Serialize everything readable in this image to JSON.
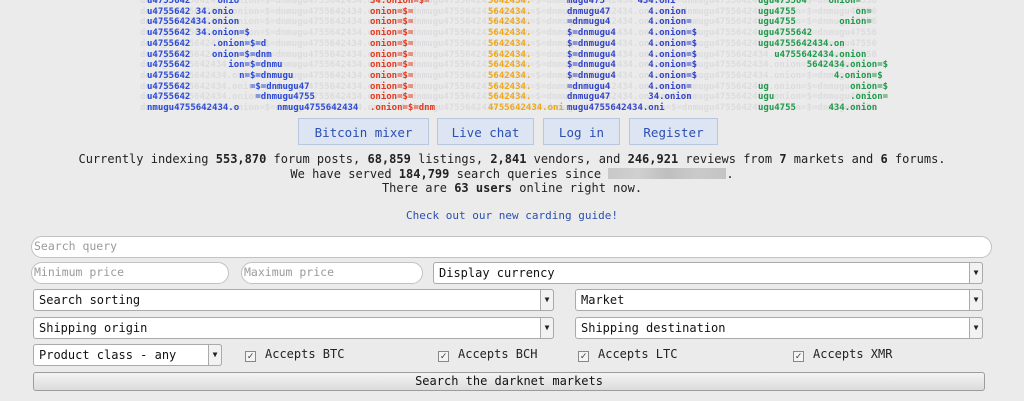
{
  "nav": {
    "items": [
      {
        "label": "Bitcoin mixer"
      },
      {
        "label": "Live chat"
      },
      {
        "label": "Log in"
      },
      {
        "label": "Register"
      }
    ]
  },
  "stats": {
    "line1_prefix": "Currently indexing ",
    "forum_posts": "553,870",
    "line1_a": " forum posts, ",
    "listings": "68,859",
    "line1_b": " listings, ",
    "vendors": "2,841",
    "line1_c": " vendors, and ",
    "reviews": "246,921",
    "line1_d": " reviews from ",
    "markets": "7",
    "line1_e": " markets and ",
    "forums": "6",
    "line1_f": " forums.",
    "line2_prefix": "We have served ",
    "queries": "184,799",
    "line2_suffix": " search queries since ",
    "line2_end": ".",
    "line3_prefix": "There are ",
    "users": "63 users",
    "line3_suffix": " online right now."
  },
  "guide_link": "Check out our new carding guide!",
  "form": {
    "search_placeholder": "Search query",
    "min_price_placeholder": "Minimum price",
    "max_price_placeholder": "Maximum price",
    "currency": "Display currency",
    "sorting": "Search sorting",
    "market": "Market",
    "shipping_origin": "Shipping origin",
    "shipping_destination": "Shipping destination",
    "product_class": "Product class - any",
    "checkboxes": [
      {
        "label": "Accepts BTC",
        "checked": true
      },
      {
        "label": "Accepts BCH",
        "checked": true
      },
      {
        "label": "Accepts LTC",
        "checked": true
      },
      {
        "label": "Accepts XMR",
        "checked": true
      }
    ],
    "submit": "Search the darknet markets"
  },
  "banner": {
    "col_blue": "u4755642     onio\nu4755642 34.onio\nu4755642434.onion\nu4755642 34.onion=$\nu4755642    .onion=$=d\nu4755642    onion=$=dnm\nu4755642       ion=$=dnmu\nu4755642         n=$=dnmugu\nu4755642           =$=dnmugu47\nu4755642            =dnmugu4755\nnmugu4755642434.o       nmugu4755642434",
    "col_red": "34.onion=$=\nonion=$=\nonion=$=\nonion=$=\nonion=$=\nonion=$=\nonion=$=\nonion=$=\nonion=$=\nonion=$=\n.onion=$=dnm",
    "col_orange": "5642434.\n5642434.\n5642434.\n5642434.\n5642434.\n5642434.\n5642434.\n5642434.\n5642434.\n5642434.\n4755642434.oni",
    "col_navy": "mugu475      434.oni\ndnmugu47       4.onion\n=dnmugu4       4.onion=\n$=dnmugu4      4.onion=$\n$=dnmugu4      4.onion=$\n$=dnmugu4      4.onion=$\n$=dnmugu4      4.onion=$\n$=dnmugu4      4.onion=$\n=dnmugu4       4.onion=\ndnmugu47       34.onion\nmugu4755642434.oni\n      755642434",
    "col_green": "ugu475564    onion=\nugu4755           on=\nugu4755        onion=\nugu4755642\nugu4755642434.on\n   u4755642434.onion\n         5642434.onion=$\n              4.onion=$\nug               onion=$\nugu              .onion=\nugu4755      434.onion\n  755642434."
  }
}
